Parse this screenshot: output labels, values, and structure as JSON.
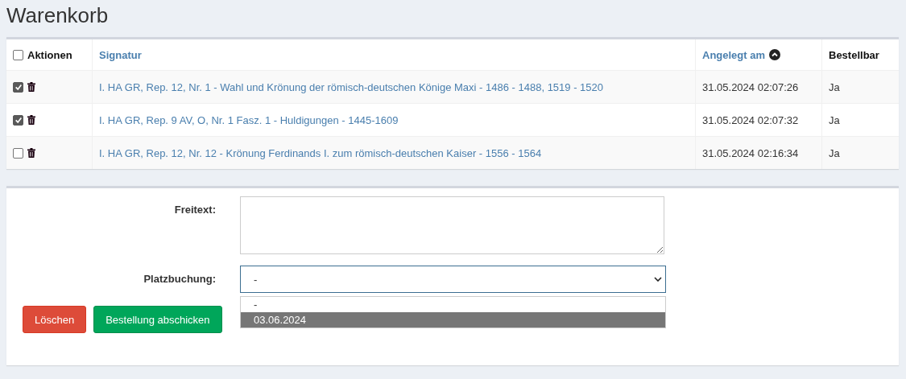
{
  "title": "Warenkorb",
  "table": {
    "select_all": {
      "checked": false
    },
    "columns": [
      {
        "label": "Aktionen",
        "kind": "checkbox"
      },
      {
        "label": "Signatur",
        "kind": "link"
      },
      {
        "label": "Angelegt am",
        "kind": "link",
        "sorted": true
      },
      {
        "label": "Bestellbar",
        "kind": "text"
      }
    ],
    "rows": [
      {
        "checked": true,
        "signatur": "I. HA GR, Rep. 12, Nr. 1 - Wahl und Krönung der römisch-deutschen Könige Maxi - 1486 - 1488, 1519 - 1520",
        "angelegt": "31.05.2024 02:07:26",
        "bestellbar": "Ja"
      },
      {
        "checked": true,
        "signatur": "I. HA GR, Rep. 9 AV, O, Nr. 1 Fasz. 1 - Huldigungen - 1445-1609",
        "angelegt": "31.05.2024 02:07:32",
        "bestellbar": "Ja"
      },
      {
        "checked": false,
        "signatur": "I. HA GR, Rep. 12, Nr. 12 - Krönung Ferdinands I. zum römisch-deutschen Kaiser - 1556 - 1564",
        "angelegt": "31.05.2024 02:16:34",
        "bestellbar": "Ja"
      }
    ]
  },
  "form": {
    "freitext": {
      "label": "Freitext:"
    },
    "platzbuchung": {
      "label": "Platzbuchung:",
      "value": "-",
      "expanded": true,
      "options": [
        {
          "label": "-",
          "highlighted": false
        },
        {
          "label": "03.06.2024",
          "highlighted": true
        }
      ]
    },
    "buttons": [
      {
        "label": "Löschen",
        "kind": "danger"
      },
      {
        "label": "Bestellung abschicken",
        "kind": "success"
      }
    ]
  }
}
